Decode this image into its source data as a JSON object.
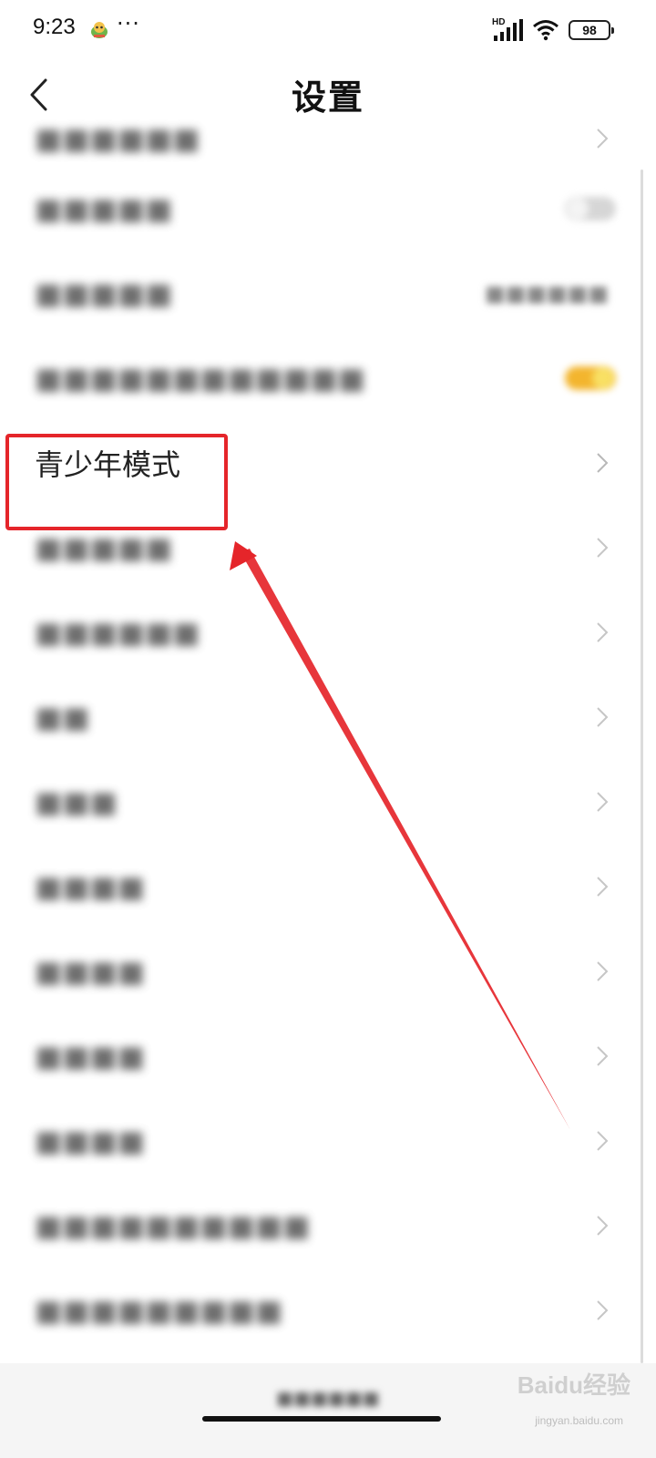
{
  "status_bar": {
    "time": "9:23",
    "more": "···",
    "network_label": "HD",
    "battery_level": "98"
  },
  "header": {
    "title": "设置",
    "back_icon": "chevron-left-icon"
  },
  "settings": {
    "items": [
      {
        "label": "青少年模式",
        "accessory": "chevron",
        "highlighted": true
      }
    ]
  },
  "annotation": {
    "color": "#e5252a"
  },
  "watermark": {
    "brand": "Baidu经验",
    "url": "jingyan.baidu.com"
  }
}
